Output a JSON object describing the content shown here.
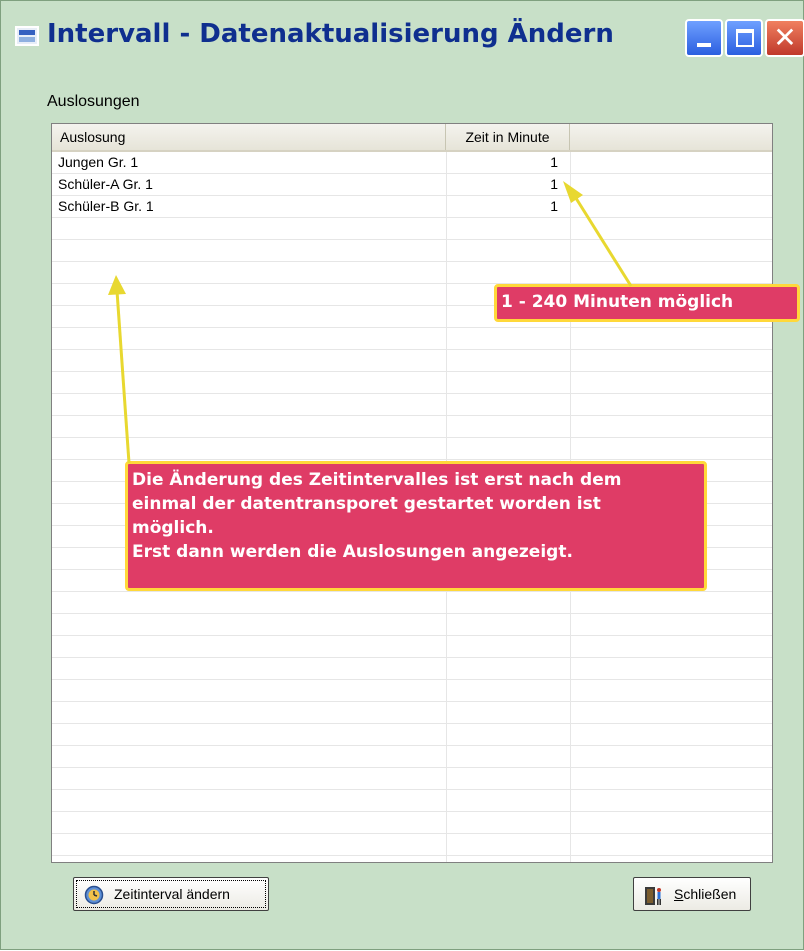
{
  "window": {
    "title": "Intervall - Datenaktualisierung Ändern"
  },
  "group": {
    "label": "Auslosungen"
  },
  "table": {
    "columns": [
      "Auslosung",
      "Zeit in Minute"
    ],
    "rows": [
      {
        "name": "Jungen  Gr. 1",
        "minutes": "1"
      },
      {
        "name": "Schüler-A  Gr. 1",
        "minutes": "1"
      },
      {
        "name": "Schüler-B  Gr. 1",
        "minutes": "1"
      }
    ]
  },
  "annotations": {
    "range_note": "1 - 240 Minuten möglich",
    "info_lines": [
      "Die Änderung des Zeitintervalles ist erst nach dem",
      "einmal der datentransporet gestartet worden ist",
      "möglich.",
      "Erst dann werden die Auslosungen angezeigt."
    ]
  },
  "buttons": {
    "change_label": "Zeitinterval ändern",
    "close_label": "Schließen"
  },
  "colors": {
    "callout_fill": "#df3c66",
    "callout_border": "#ffd83a",
    "window_bg": "#c8e0c8",
    "title_text": "#0f2f8f"
  }
}
